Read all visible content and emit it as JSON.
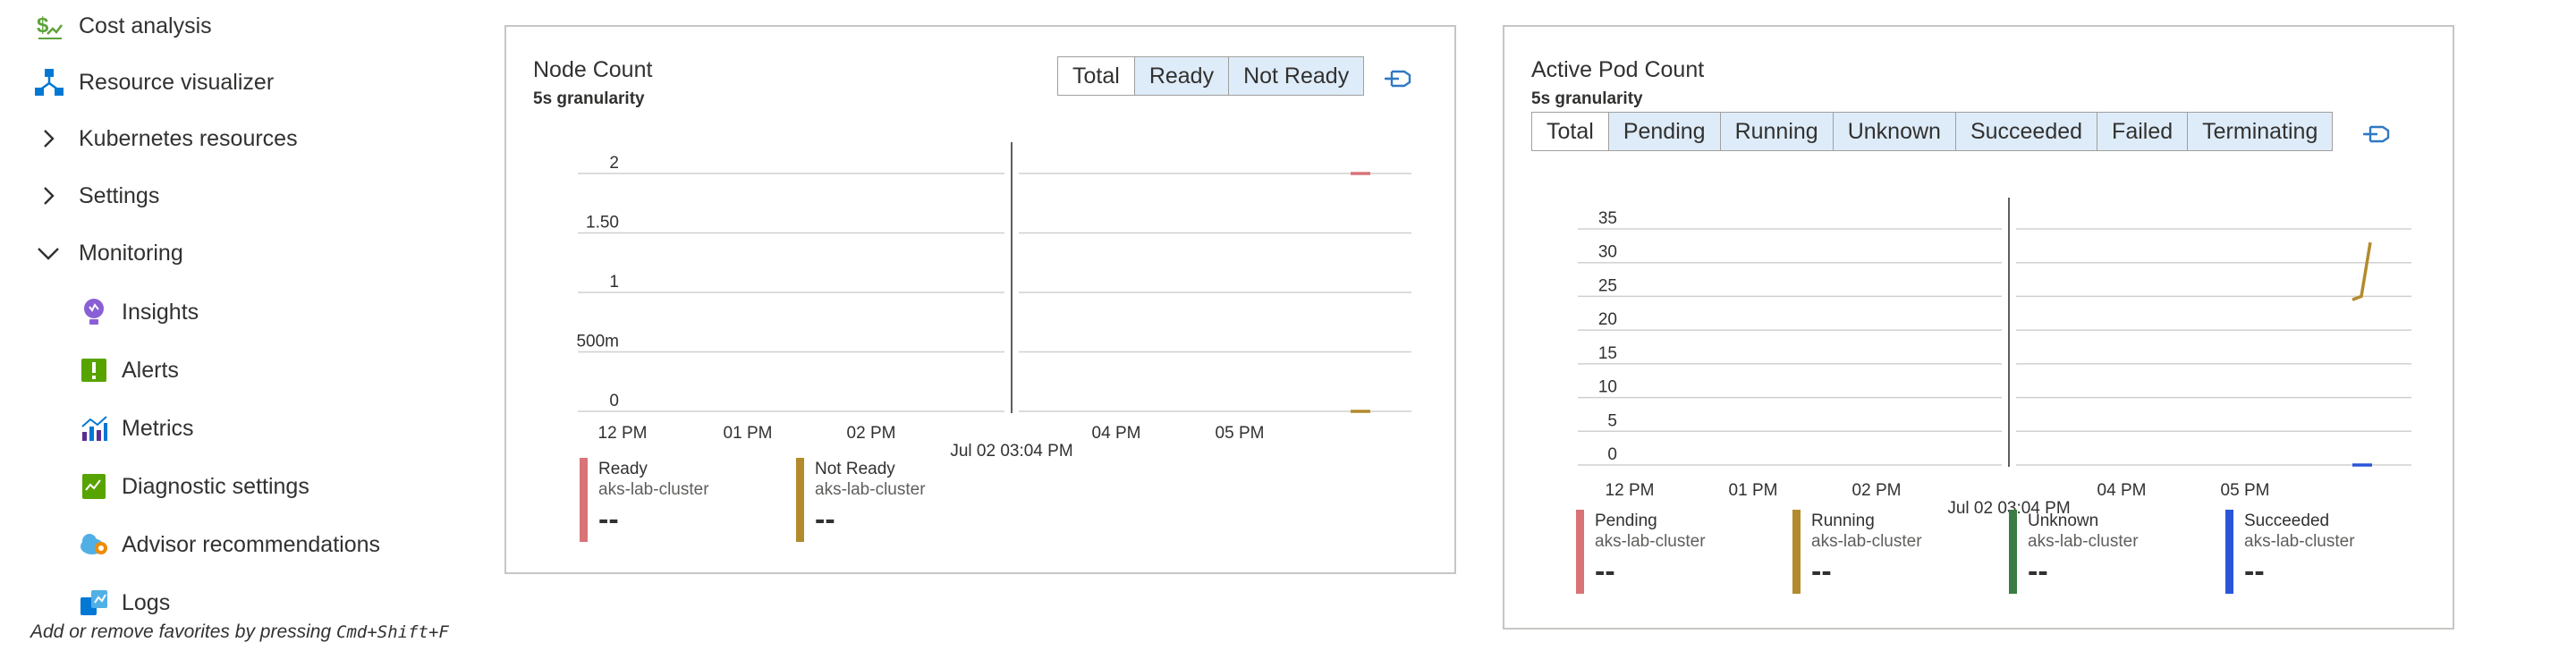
{
  "sidebar": {
    "items": [
      {
        "label": "Cost analysis",
        "icon": "cost-analysis-icon"
      },
      {
        "label": "Resource visualizer",
        "icon": "resource-visualizer-icon"
      },
      {
        "label": "Kubernetes resources",
        "icon": "chevron-right-icon"
      },
      {
        "label": "Settings",
        "icon": "chevron-right-icon"
      },
      {
        "label": "Monitoring",
        "icon": "chevron-down-icon"
      },
      {
        "label": "Insights",
        "icon": "insights-icon"
      },
      {
        "label": "Alerts",
        "icon": "alerts-icon"
      },
      {
        "label": "Metrics",
        "icon": "metrics-icon"
      },
      {
        "label": "Diagnostic settings",
        "icon": "diagnostic-settings-icon"
      },
      {
        "label": "Advisor recommendations",
        "icon": "advisor-recommendations-icon"
      },
      {
        "label": "Logs",
        "icon": "logs-icon"
      }
    ],
    "hint_prefix": "Add or remove favorites by pressing ",
    "hint_keys": "Cmd+Shift+F"
  },
  "colors": {
    "ready": "#d87378",
    "not_ready": "#b38b2d",
    "pending": "#d87378",
    "running": "#b38b2d",
    "unknown": "#3a7d44",
    "succeeded": "#2b55d8",
    "grid": "#d2d0ce",
    "tab_bg": "#deecf9",
    "pin": "#2f78c4"
  },
  "node_card": {
    "title": "Node Count",
    "granularity": "5s granularity",
    "tabs": [
      "Total",
      "Ready",
      "Not Ready"
    ],
    "active_tab": "Total",
    "pin_icon": "pin-icon",
    "legend": [
      {
        "name": "Ready",
        "cluster": "aks-lab-cluster",
        "value": "--"
      },
      {
        "name": "Not Ready",
        "cluster": "aks-lab-cluster",
        "value": "--"
      }
    ]
  },
  "pod_card": {
    "title": "Active Pod Count",
    "granularity": "5s granularity",
    "tabs": [
      "Total",
      "Pending",
      "Running",
      "Unknown",
      "Succeeded",
      "Failed",
      "Terminating"
    ],
    "active_tab": "Total",
    "pin_icon": "pin-icon",
    "legend": [
      {
        "name": "Pending",
        "cluster": "aks-lab-cluster",
        "value": "--"
      },
      {
        "name": "Running",
        "cluster": "aks-lab-cluster",
        "value": "--"
      },
      {
        "name": "Unknown",
        "cluster": "aks-lab-cluster",
        "value": "--"
      },
      {
        "name": "Succeeded",
        "cluster": "aks-lab-cluster",
        "value": "--"
      }
    ]
  },
  "chart_data": [
    {
      "type": "line",
      "title": "Node Count",
      "subtitle": "5s granularity",
      "x_ticks": [
        "12 PM",
        "01 PM",
        "02 PM",
        "04 PM",
        "05 PM"
      ],
      "cursor_label": "Jul 02 03:04 PM",
      "y_ticks": [
        "0",
        "500m",
        "1",
        "1.50",
        "2"
      ],
      "ylim": [
        0,
        2
      ],
      "grid": true,
      "legend_position": "bottom",
      "series": [
        {
          "name": "Ready",
          "cluster": "aks-lab-cluster",
          "values": [
            2,
            2
          ]
        },
        {
          "name": "Not Ready",
          "cluster": "aks-lab-cluster",
          "values": [
            0,
            0
          ]
        }
      ]
    },
    {
      "type": "line",
      "title": "Active Pod Count",
      "subtitle": "5s granularity",
      "x_ticks": [
        "12 PM",
        "01 PM",
        "02 PM",
        "04 PM",
        "05 PM"
      ],
      "cursor_label": "Jul 02 03:04 PM",
      "y_ticks": [
        "0",
        "5",
        "10",
        "15",
        "20",
        "25",
        "30",
        "35"
      ],
      "ylim": [
        0,
        35
      ],
      "grid": true,
      "legend_position": "bottom",
      "series": [
        {
          "name": "Running",
          "cluster": "aks-lab-cluster",
          "values": [
            24.5,
            25,
            33
          ]
        },
        {
          "name": "Succeeded",
          "cluster": "aks-lab-cluster",
          "values": [
            0,
            0
          ]
        }
      ]
    }
  ]
}
